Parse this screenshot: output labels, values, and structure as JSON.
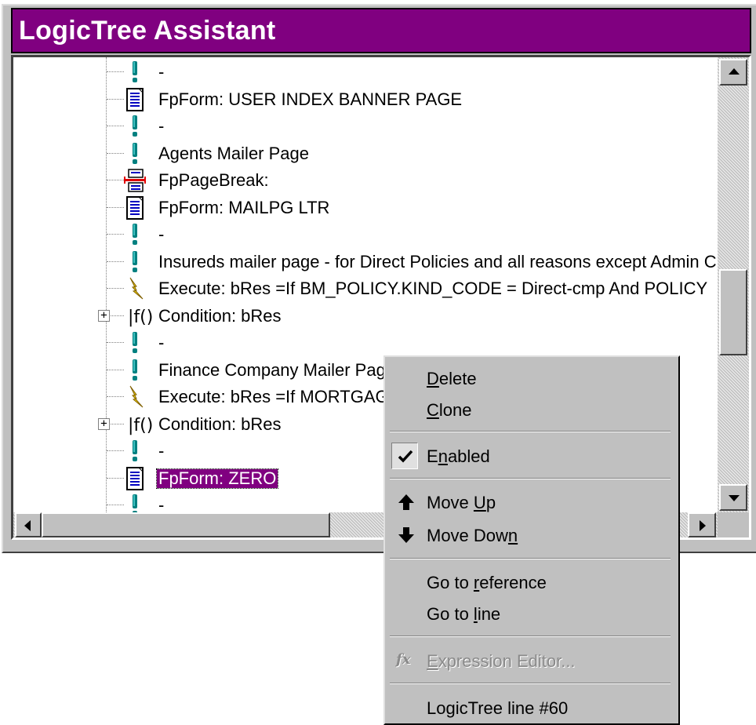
{
  "window": {
    "title": "LogicTree Assistant",
    "title_color": "#800080"
  },
  "tree": {
    "rows": [
      {
        "icon": "exclamation-icon",
        "label": "-"
      },
      {
        "icon": "form-page-icon",
        "label": "FpForm: USER INDEX BANNER PAGE"
      },
      {
        "icon": "exclamation-icon",
        "label": "-"
      },
      {
        "icon": "exclamation-icon",
        "label": "Agents Mailer Page"
      },
      {
        "icon": "page-break-icon",
        "label": "FpPageBreak:"
      },
      {
        "icon": "form-page-icon",
        "label": "FpForm: MAILPG LTR"
      },
      {
        "icon": "exclamation-icon",
        "label": "-"
      },
      {
        "icon": "exclamation-icon",
        "label": "Insureds mailer page - for Direct Policies and all reasons except Admin Cha"
      },
      {
        "icon": "lightning-icon",
        "label": "Execute: bRes =If BM_POLICY.KIND_CODE = Direct-cmp And POLICY"
      },
      {
        "icon": "condition-icon",
        "label": "Condition: bRes",
        "expandable": true,
        "expander": "+"
      },
      {
        "icon": "exclamation-icon",
        "label": "-"
      },
      {
        "icon": "exclamation-icon",
        "label": "Finance Company Mailer Page"
      },
      {
        "icon": "lightning-icon",
        "label": "Execute: bRes =If MORTGAGEE And"
      },
      {
        "icon": "condition-icon",
        "label": "Condition: bRes",
        "expandable": true,
        "expander": "+"
      },
      {
        "icon": "exclamation-icon",
        "label": "-"
      },
      {
        "icon": "form-page-icon",
        "label": "FpForm: ZERO",
        "selected": true
      },
      {
        "icon": "exclamation-icon",
        "label": "-"
      }
    ]
  },
  "context_menu": {
    "delete": "Delete",
    "clone": "Clone",
    "enabled": "Enabled",
    "enabled_checked": true,
    "move_up": "Move Up",
    "move_down": "Move Down",
    "go_to_reference": "Go to reference",
    "go_to_line": "Go to line",
    "expression_editor": "Expression Editor...",
    "expression_editor_disabled": true,
    "logictree_line": "LogicTree line #60"
  }
}
